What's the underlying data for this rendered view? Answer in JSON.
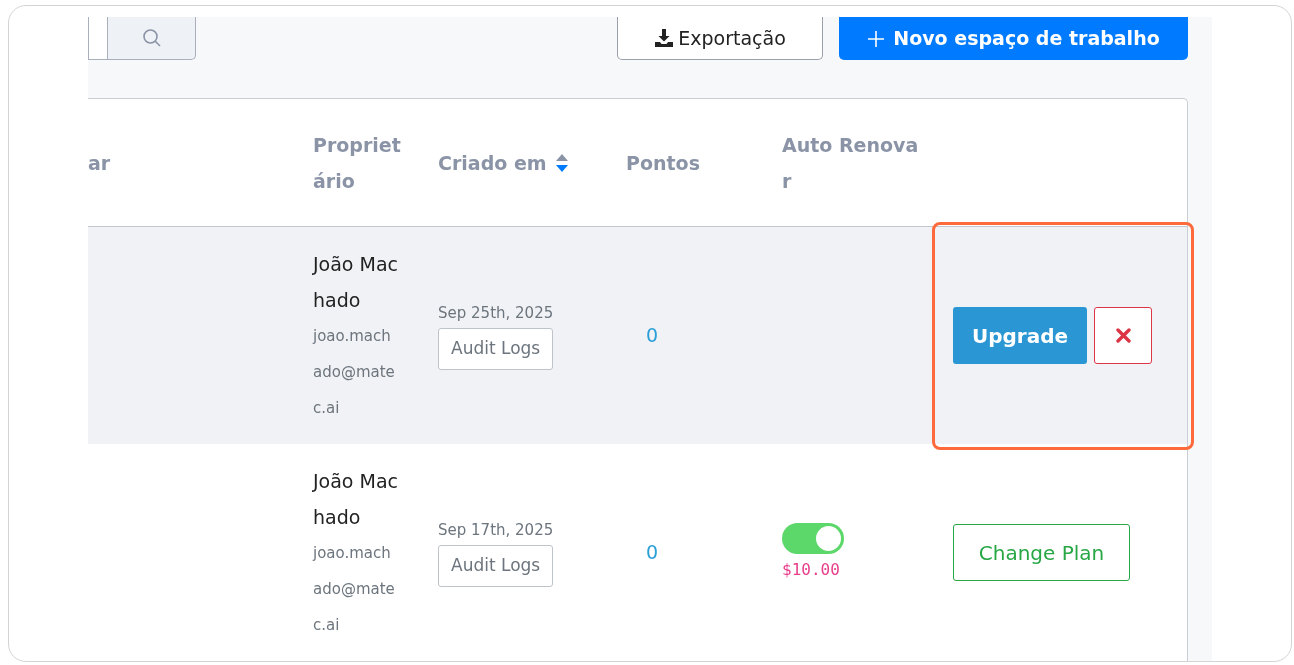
{
  "toolbar": {
    "export_button": "Exportação",
    "new_button": "Novo espaço de trabalho"
  },
  "table": {
    "columns": [
      {
        "label": "ar",
        "sorted_descending": false
      },
      {
        "label": "Proprietário",
        "sorted_descending": false
      },
      {
        "label": "Criado em",
        "sorted_descending": true
      },
      {
        "label": "Pontos",
        "sorted_descending": false
      },
      {
        "label": "Auto Renovar",
        "sorted_descending": false
      }
    ],
    "rows": [
      {
        "hovered": true,
        "owner_name": "João Machado",
        "owner_email": "joao.machado@matec.ai",
        "created": "Sep 25th, 2025",
        "audit_button": "Audit Logs",
        "points": "0",
        "callout": true,
        "actions": [
          {
            "kind": "upgrade",
            "label": "Upgrade"
          },
          {
            "kind": "delete"
          }
        ]
      },
      {
        "hovered": false,
        "owner_name": "João Machado",
        "owner_email": "joao.machado@matec.ai",
        "created": "Sep 17th, 2025",
        "audit_button": "Audit Logs",
        "points": "0",
        "auto_renew": {
          "on": true,
          "price": "$10.00"
        },
        "callout": false,
        "actions": [
          {
            "kind": "change_plan",
            "label": "Change Plan"
          }
        ]
      }
    ]
  }
}
